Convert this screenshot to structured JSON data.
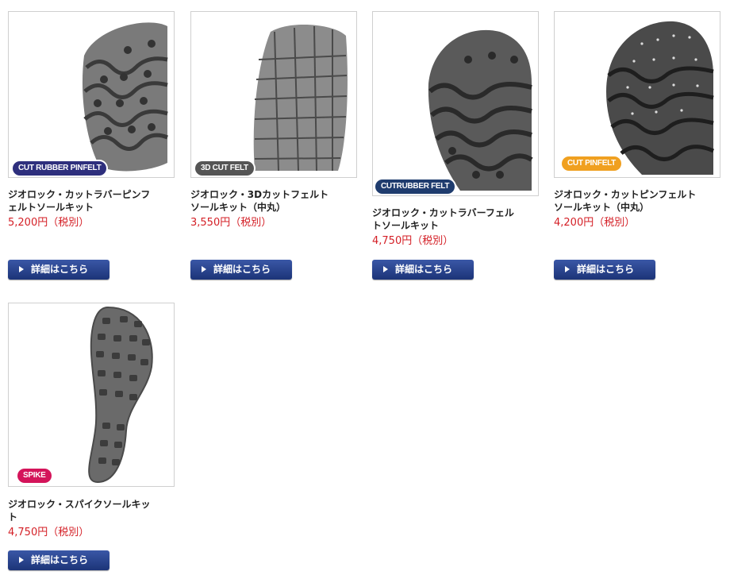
{
  "button_label": "詳細はこちら",
  "products": [
    {
      "name": "ジオロック・カットラバーピンフェルトソールキット",
      "price": "5,200円（税別）",
      "badge": "CUT RUBBER PINFELT",
      "badge_color": "#2e2f7d",
      "image": "cut-rubber-pinfelt-sole"
    },
    {
      "name": "ジオロック・3Dカットフェルトソールキット（中丸）",
      "price": "3,550円（税別）",
      "badge": "3D CUT FELT",
      "badge_color": "#555555",
      "image": "3d-cut-felt-sole"
    },
    {
      "name": "ジオロック・カットラバーフェルトソールキット",
      "price": "4,750円（税別）",
      "badge": "CUTRUBBER FELT",
      "badge_color": "#1f3c6e",
      "image": "cut-rubber-felt-sole"
    },
    {
      "name": "ジオロック・カットピンフェルトソールキット（中丸）",
      "price": "4,200円（税別）",
      "badge": "CUT PINFELT",
      "badge_color": "#f0a020",
      "image": "cut-pinfelt-sole"
    },
    {
      "name": "ジオロック・スパイクソールキット",
      "price": "4,750円（税別）",
      "badge": "SPIKE",
      "badge_color": "#d4145a",
      "image": "spike-sole"
    }
  ]
}
